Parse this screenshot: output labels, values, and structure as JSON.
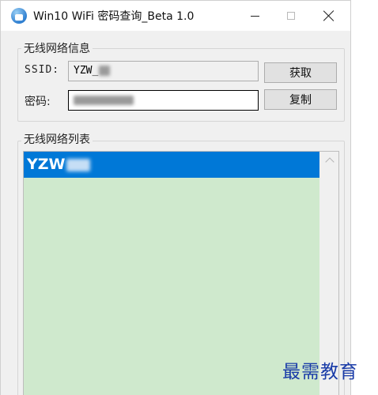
{
  "window": {
    "title": "Win10 WiFi 密码查询_Beta 1.0",
    "icon": "wifi-app-icon"
  },
  "info_group": {
    "title": "无线网络信息",
    "ssid_label": "SSID:",
    "ssid_value": "YZW_",
    "password_label": "密码:",
    "get_button": "获取",
    "copy_button": "复制"
  },
  "list_group": {
    "title": "无线网络列表",
    "items": [
      {
        "label": "YZW",
        "selected": true
      }
    ]
  },
  "watermark": "最需教育",
  "colors": {
    "selection": "#0078d7",
    "list_background": "#cfe9cd",
    "watermark": "#1a3ca8"
  }
}
